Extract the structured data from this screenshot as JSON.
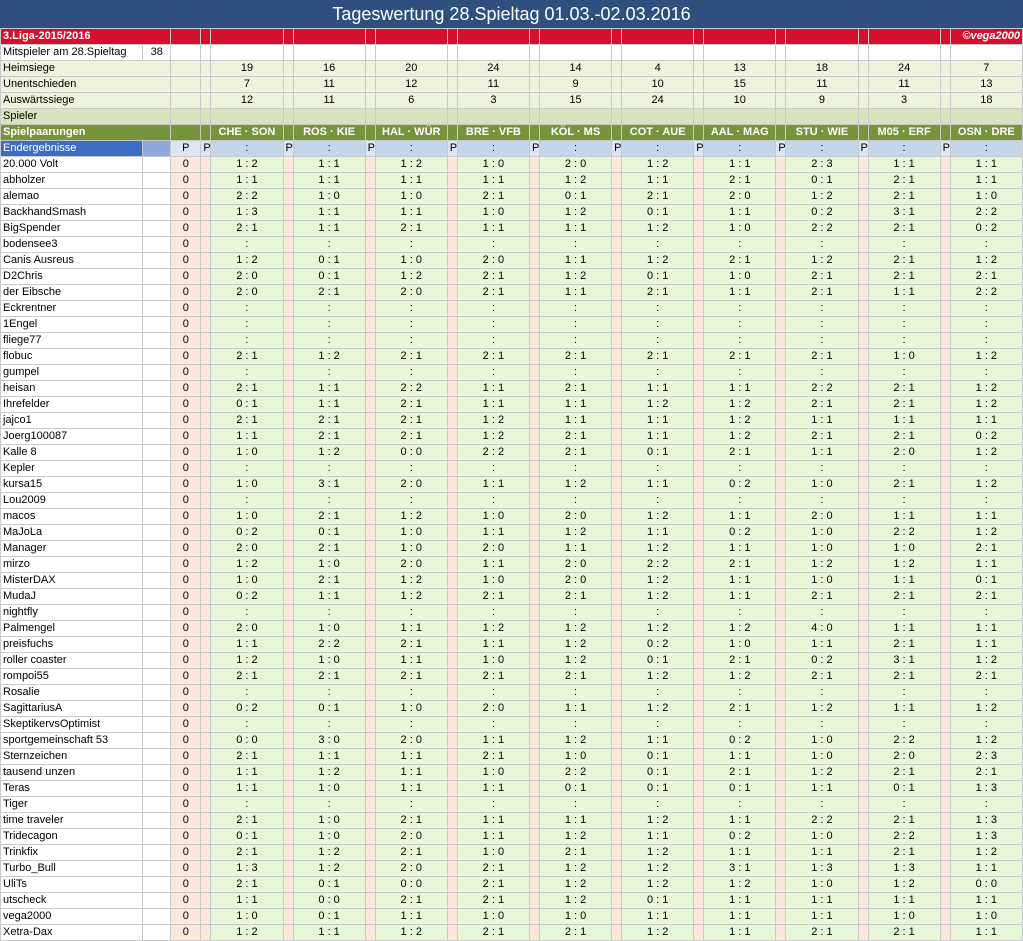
{
  "title": "Tageswertung 28.Spieltag 01.03.-02.03.2016",
  "league": "3.Liga-2015/2016",
  "copyright": "©vega2000",
  "mitspieler_label": "Mitspieler am 28.Spieltag",
  "mitspieler_count": "38",
  "heimsiege_label": "Heimsiege",
  "unentschieden_label": "Unentschieden",
  "auswaerts_label": "Auswärtssiege",
  "spieler_label": "Spieler",
  "spielpaarungen_label": "Spielpaarungen",
  "endergebnisse_label": "Endergebnisse",
  "p_label": "P",
  "result_placeholder": ":",
  "heimsiege": [
    "19",
    "16",
    "20",
    "24",
    "14",
    "4",
    "13",
    "18",
    "24",
    "7"
  ],
  "unentschieden": [
    "7",
    "11",
    "12",
    "11",
    "9",
    "10",
    "15",
    "11",
    "11",
    "13"
  ],
  "auswaertssiege": [
    "12",
    "11",
    "6",
    "3",
    "15",
    "24",
    "10",
    "9",
    "3",
    "18"
  ],
  "matches": [
    "CHE · SON",
    "ROS · KIE",
    "HAL · WÜR",
    "BRE · VFB",
    "KÖL · MS",
    "COT · AUE",
    "AAL · MAG",
    "STU · WIE",
    "M05 · ERF",
    "OSN · DRE"
  ],
  "players": [
    {
      "name": "20.000 Volt",
      "points": "0",
      "tips": [
        "1 : 2",
        "1 : 1",
        "1 : 2",
        "1 : 0",
        "2 : 0",
        "1 : 2",
        "1 : 1",
        "2 : 3",
        "1 : 1",
        "1 : 1"
      ]
    },
    {
      "name": "abholzer",
      "points": "0",
      "tips": [
        "1 : 1",
        "1 : 1",
        "1 : 1",
        "1 : 1",
        "1 : 2",
        "1 : 1",
        "2 : 1",
        "0 : 1",
        "2 : 1",
        "1 : 1"
      ]
    },
    {
      "name": "alemao",
      "points": "0",
      "tips": [
        "2 : 2",
        "1 : 0",
        "1 : 0",
        "2 : 1",
        "0 : 1",
        "2 : 1",
        "2 : 0",
        "1 : 2",
        "2 : 1",
        "1 : 0"
      ]
    },
    {
      "name": "BackhandSmash",
      "points": "0",
      "tips": [
        "1 : 3",
        "1 : 1",
        "1 : 1",
        "1 : 0",
        "1 : 2",
        "0 : 1",
        "1 : 1",
        "0 : 2",
        "3 : 1",
        "2 : 2"
      ]
    },
    {
      "name": "BigSpender",
      "points": "0",
      "tips": [
        "2 : 1",
        "1 : 1",
        "2 : 1",
        "1 : 1",
        "1 : 1",
        "1 : 2",
        "1 : 0",
        "2 : 2",
        "2 : 1",
        "0 : 2"
      ]
    },
    {
      "name": "bodensee3",
      "points": "0",
      "tips": [
        ":",
        ":",
        ":",
        ":",
        ":",
        ":",
        ":",
        ":",
        ":",
        ":"
      ]
    },
    {
      "name": "Canis Ausreus",
      "points": "0",
      "tips": [
        "1 : 2",
        "0 : 1",
        "1 : 0",
        "2 : 0",
        "1 : 1",
        "1 : 2",
        "2 : 1",
        "1 : 2",
        "2 : 1",
        "1 : 2"
      ]
    },
    {
      "name": "D2Chris",
      "points": "0",
      "tips": [
        "2 : 0",
        "0 : 1",
        "1 : 2",
        "2 : 1",
        "1 : 2",
        "0 : 1",
        "1 : 0",
        "2 : 1",
        "2 : 1",
        "2 : 1"
      ]
    },
    {
      "name": "der Eibsche",
      "points": "0",
      "tips": [
        "2 : 0",
        "2 : 1",
        "2 : 0",
        "2 : 1",
        "1 : 1",
        "2 : 1",
        "1 : 1",
        "2 : 1",
        "1 : 1",
        "2 : 2"
      ]
    },
    {
      "name": "Eckrentner",
      "points": "0",
      "tips": [
        ":",
        ":",
        ":",
        ":",
        ":",
        ":",
        ":",
        ":",
        ":",
        ":"
      ]
    },
    {
      "name": "1Engel",
      "points": "0",
      "tips": [
        ":",
        ":",
        ":",
        ":",
        ":",
        ":",
        ":",
        ":",
        ":",
        ":"
      ]
    },
    {
      "name": "fliege77",
      "points": "0",
      "tips": [
        ":",
        ":",
        ":",
        ":",
        ":",
        ":",
        ":",
        ":",
        ":",
        ":"
      ]
    },
    {
      "name": "flobuc",
      "points": "0",
      "tips": [
        "2 : 1",
        "1 : 2",
        "2 : 1",
        "2 : 1",
        "2 : 1",
        "2 : 1",
        "2 : 1",
        "2 : 1",
        "1 : 0",
        "1 : 2"
      ]
    },
    {
      "name": "gumpel",
      "points": "0",
      "tips": [
        ":",
        ":",
        ":",
        ":",
        ":",
        ":",
        ":",
        ":",
        ":",
        ":"
      ]
    },
    {
      "name": "heisan",
      "points": "0",
      "tips": [
        "2 : 1",
        "1 : 1",
        "2 : 2",
        "1 : 1",
        "2 : 1",
        "1 : 1",
        "1 : 1",
        "2 : 2",
        "2 : 1",
        "1 : 2"
      ]
    },
    {
      "name": "Ihrefelder",
      "points": "0",
      "tips": [
        "0 : 1",
        "1 : 1",
        "2 : 1",
        "1 : 1",
        "1 : 1",
        "1 : 2",
        "1 : 2",
        "2 : 1",
        "2 : 1",
        "1 : 2"
      ]
    },
    {
      "name": "jajco1",
      "points": "0",
      "tips": [
        "2 : 1",
        "2 : 1",
        "2 : 1",
        "1 : 2",
        "1 : 1",
        "1 : 1",
        "1 : 2",
        "1 : 1",
        "1 : 1",
        "1 : 1"
      ]
    },
    {
      "name": "Joerg100087",
      "points": "0",
      "tips": [
        "1 : 1",
        "2 : 1",
        "2 : 1",
        "1 : 2",
        "2 : 1",
        "1 : 1",
        "1 : 2",
        "2 : 1",
        "2 : 1",
        "0 : 2"
      ]
    },
    {
      "name": "Kalle 8",
      "points": "0",
      "tips": [
        "1 : 0",
        "1 : 2",
        "0 : 0",
        "2 : 2",
        "2 : 1",
        "0 : 1",
        "2 : 1",
        "1 : 1",
        "2 : 0",
        "1 : 2"
      ]
    },
    {
      "name": "Kepler",
      "points": "0",
      "tips": [
        ":",
        ":",
        ":",
        ":",
        ":",
        ":",
        ":",
        ":",
        ":",
        ":"
      ]
    },
    {
      "name": "kursa15",
      "points": "0",
      "tips": [
        "1 : 0",
        "3 : 1",
        "2 : 0",
        "1 : 1",
        "1 : 2",
        "1 : 1",
        "0 : 2",
        "1 : 0",
        "2 : 1",
        "1 : 2"
      ]
    },
    {
      "name": "Lou2009",
      "points": "0",
      "tips": [
        ":",
        ":",
        ":",
        ":",
        ":",
        ":",
        ":",
        ":",
        ":",
        ":"
      ]
    },
    {
      "name": "macos",
      "points": "0",
      "tips": [
        "1 : 0",
        "2 : 1",
        "1 : 2",
        "1 : 0",
        "2 : 0",
        "1 : 2",
        "1 : 1",
        "2 : 0",
        "1 : 1",
        "1 : 1"
      ]
    },
    {
      "name": "MaJoLa",
      "points": "0",
      "tips": [
        "0 : 2",
        "0 : 1",
        "1 : 0",
        "1 : 1",
        "1 : 2",
        "1 : 1",
        "0 : 2",
        "1 : 0",
        "2 : 2",
        "1 : 2"
      ]
    },
    {
      "name": "Manager",
      "points": "0",
      "tips": [
        "2 : 0",
        "2 : 1",
        "1 : 0",
        "2 : 0",
        "1 : 1",
        "1 : 2",
        "1 : 1",
        "1 : 0",
        "1 : 0",
        "2 : 1"
      ]
    },
    {
      "name": "mirzo",
      "points": "0",
      "tips": [
        "1 : 2",
        "1 : 0",
        "2 : 0",
        "1 : 1",
        "2 : 0",
        "2 : 2",
        "2 : 1",
        "1 : 2",
        "1 : 2",
        "1 : 1"
      ]
    },
    {
      "name": "MisterDAX",
      "points": "0",
      "tips": [
        "1 : 0",
        "2 : 1",
        "1 : 2",
        "1 : 0",
        "2 : 0",
        "1 : 2",
        "1 : 1",
        "1 : 0",
        "1 : 1",
        "0 : 1"
      ]
    },
    {
      "name": "MudaJ",
      "points": "0",
      "tips": [
        "0 : 2",
        "1 : 1",
        "1 : 2",
        "2 : 1",
        "2 : 1",
        "1 : 2",
        "1 : 1",
        "2 : 1",
        "2 : 1",
        "2 : 1"
      ]
    },
    {
      "name": "nightfly",
      "points": "0",
      "tips": [
        ":",
        ":",
        ":",
        ":",
        ":",
        ":",
        ":",
        ":",
        ":",
        ":"
      ]
    },
    {
      "name": "Palmengel",
      "points": "0",
      "tips": [
        "2 : 0",
        "1 : 0",
        "1 : 1",
        "1 : 2",
        "1 : 2",
        "1 : 2",
        "1 : 2",
        "4 : 0",
        "1 : 1",
        "1 : 1"
      ]
    },
    {
      "name": "preisfuchs",
      "points": "0",
      "tips": [
        "1 : 1",
        "2 : 2",
        "2 : 1",
        "1 : 1",
        "1 : 2",
        "0 : 2",
        "1 : 0",
        "1 : 1",
        "2 : 1",
        "1 : 1"
      ]
    },
    {
      "name": "roller coaster",
      "points": "0",
      "tips": [
        "1 : 2",
        "1 : 0",
        "1 : 1",
        "1 : 0",
        "1 : 2",
        "0 : 1",
        "2 : 1",
        "0 : 2",
        "3 : 1",
        "1 : 2"
      ]
    },
    {
      "name": "rompoi55",
      "points": "0",
      "tips": [
        "2 : 1",
        "2 : 1",
        "2 : 1",
        "2 : 1",
        "2 : 1",
        "1 : 2",
        "1 : 2",
        "2 : 1",
        "2 : 1",
        "2 : 1"
      ]
    },
    {
      "name": "Rosalie",
      "points": "0",
      "tips": [
        ":",
        ":",
        ":",
        ":",
        ":",
        ":",
        ":",
        ":",
        ":",
        ":"
      ]
    },
    {
      "name": "SagittariusA",
      "points": "0",
      "tips": [
        "0 : 2",
        "0 : 1",
        "1 : 0",
        "2 : 0",
        "1 : 1",
        "1 : 2",
        "2 : 1",
        "1 : 2",
        "1 : 1",
        "1 : 2"
      ]
    },
    {
      "name": "SkeptikervsOptimist",
      "points": "0",
      "tips": [
        ":",
        ":",
        ":",
        ":",
        ":",
        ":",
        ":",
        ":",
        ":",
        ":"
      ]
    },
    {
      "name": "sportgemeinschaft 53",
      "points": "0",
      "tips": [
        "0 : 0",
        "3 : 0",
        "2 : 0",
        "1 : 1",
        "1 : 2",
        "1 : 1",
        "0 : 2",
        "1 : 0",
        "2 : 2",
        "1 : 2"
      ]
    },
    {
      "name": "Sternzeichen",
      "points": "0",
      "tips": [
        "2 : 1",
        "1 : 1",
        "1 : 1",
        "2 : 1",
        "1 : 0",
        "0 : 1",
        "1 : 1",
        "1 : 0",
        "2 : 0",
        "2 : 3"
      ]
    },
    {
      "name": "tausend unzen",
      "points": "0",
      "tips": [
        "1 : 1",
        "1 : 2",
        "1 : 1",
        "1 : 0",
        "2 : 2",
        "0 : 1",
        "2 : 1",
        "1 : 2",
        "2 : 1",
        "2 : 1"
      ]
    },
    {
      "name": "Teras",
      "points": "0",
      "tips": [
        "1 : 1",
        "1 : 0",
        "1 : 1",
        "1 : 1",
        "0 : 1",
        "0 : 1",
        "0 : 1",
        "1 : 1",
        "0 : 1",
        "1 : 3"
      ]
    },
    {
      "name": "Tiger",
      "points": "0",
      "tips": [
        ":",
        ":",
        ":",
        ":",
        ":",
        ":",
        ":",
        ":",
        ":",
        ":"
      ]
    },
    {
      "name": "time traveler",
      "points": "0",
      "tips": [
        "2 : 1",
        "1 : 0",
        "2 : 1",
        "1 : 1",
        "1 : 1",
        "1 : 2",
        "1 : 1",
        "2 : 2",
        "2 : 1",
        "1 : 3"
      ]
    },
    {
      "name": "Tridecagon",
      "points": "0",
      "tips": [
        "0 : 1",
        "1 : 0",
        "2 : 0",
        "1 : 1",
        "1 : 2",
        "1 : 1",
        "0 : 2",
        "1 : 0",
        "2 : 2",
        "1 : 3"
      ]
    },
    {
      "name": "Trinkfix",
      "points": "0",
      "tips": [
        "2 : 1",
        "1 : 2",
        "2 : 1",
        "1 : 0",
        "2 : 1",
        "1 : 2",
        "1 : 1",
        "1 : 1",
        "2 : 1",
        "1 : 2"
      ]
    },
    {
      "name": "Turbo_Bull",
      "points": "0",
      "tips": [
        "1 : 3",
        "1 : 2",
        "2 : 0",
        "2 : 1",
        "1 : 2",
        "1 : 2",
        "3 : 1",
        "1 : 3",
        "1 : 3",
        "1 : 1"
      ]
    },
    {
      "name": "UliTs",
      "points": "0",
      "tips": [
        "2 : 1",
        "0 : 1",
        "0 : 0",
        "2 : 1",
        "1 : 2",
        "1 : 2",
        "1 : 2",
        "1 : 0",
        "1 : 2",
        "0 : 0"
      ]
    },
    {
      "name": "utscheck",
      "points": "0",
      "tips": [
        "1 : 1",
        "0 : 0",
        "2 : 1",
        "2 : 1",
        "1 : 2",
        "0 : 1",
        "1 : 1",
        "1 : 1",
        "1 : 1",
        "1 : 1"
      ]
    },
    {
      "name": "vega2000",
      "points": "0",
      "tips": [
        "1 : 0",
        "0 : 1",
        "1 : 1",
        "1 : 0",
        "1 : 0",
        "1 : 1",
        "1 : 1",
        "1 : 1",
        "1 : 0",
        "1 : 0"
      ]
    },
    {
      "name": "Xetra-Dax",
      "points": "0",
      "tips": [
        "1 : 2",
        "1 : 1",
        "1 : 2",
        "2 : 1",
        "2 : 1",
        "1 : 2",
        "1 : 1",
        "2 : 1",
        "2 : 1",
        "1 : 1"
      ]
    }
  ]
}
